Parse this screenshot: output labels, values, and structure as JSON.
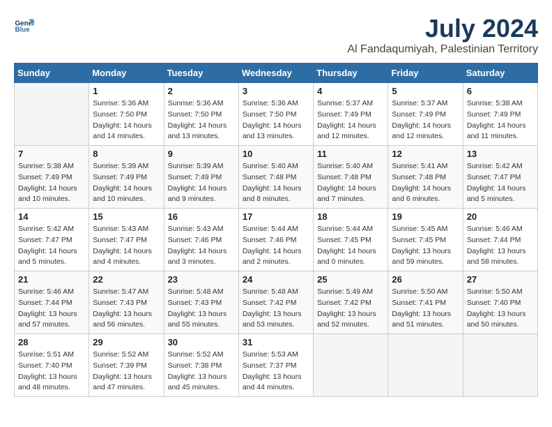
{
  "header": {
    "logo_line1": "General",
    "logo_line2": "Blue",
    "main_title": "July 2024",
    "subtitle": "Al Fandaqumiyah, Palestinian Territory"
  },
  "days_of_week": [
    "Sunday",
    "Monday",
    "Tuesday",
    "Wednesday",
    "Thursday",
    "Friday",
    "Saturday"
  ],
  "weeks": [
    [
      {
        "day": "",
        "info": ""
      },
      {
        "day": "1",
        "info": "Sunrise: 5:36 AM\nSunset: 7:50 PM\nDaylight: 14 hours\nand 14 minutes."
      },
      {
        "day": "2",
        "info": "Sunrise: 5:36 AM\nSunset: 7:50 PM\nDaylight: 14 hours\nand 13 minutes."
      },
      {
        "day": "3",
        "info": "Sunrise: 5:36 AM\nSunset: 7:50 PM\nDaylight: 14 hours\nand 13 minutes."
      },
      {
        "day": "4",
        "info": "Sunrise: 5:37 AM\nSunset: 7:49 PM\nDaylight: 14 hours\nand 12 minutes."
      },
      {
        "day": "5",
        "info": "Sunrise: 5:37 AM\nSunset: 7:49 PM\nDaylight: 14 hours\nand 12 minutes."
      },
      {
        "day": "6",
        "info": "Sunrise: 5:38 AM\nSunset: 7:49 PM\nDaylight: 14 hours\nand 11 minutes."
      }
    ],
    [
      {
        "day": "7",
        "info": "Sunrise: 5:38 AM\nSunset: 7:49 PM\nDaylight: 14 hours\nand 10 minutes."
      },
      {
        "day": "8",
        "info": "Sunrise: 5:39 AM\nSunset: 7:49 PM\nDaylight: 14 hours\nand 10 minutes."
      },
      {
        "day": "9",
        "info": "Sunrise: 5:39 AM\nSunset: 7:49 PM\nDaylight: 14 hours\nand 9 minutes."
      },
      {
        "day": "10",
        "info": "Sunrise: 5:40 AM\nSunset: 7:48 PM\nDaylight: 14 hours\nand 8 minutes."
      },
      {
        "day": "11",
        "info": "Sunrise: 5:40 AM\nSunset: 7:48 PM\nDaylight: 14 hours\nand 7 minutes."
      },
      {
        "day": "12",
        "info": "Sunrise: 5:41 AM\nSunset: 7:48 PM\nDaylight: 14 hours\nand 6 minutes."
      },
      {
        "day": "13",
        "info": "Sunrise: 5:42 AM\nSunset: 7:47 PM\nDaylight: 14 hours\nand 5 minutes."
      }
    ],
    [
      {
        "day": "14",
        "info": "Sunrise: 5:42 AM\nSunset: 7:47 PM\nDaylight: 14 hours\nand 5 minutes."
      },
      {
        "day": "15",
        "info": "Sunrise: 5:43 AM\nSunset: 7:47 PM\nDaylight: 14 hours\nand 4 minutes."
      },
      {
        "day": "16",
        "info": "Sunrise: 5:43 AM\nSunset: 7:46 PM\nDaylight: 14 hours\nand 3 minutes."
      },
      {
        "day": "17",
        "info": "Sunrise: 5:44 AM\nSunset: 7:46 PM\nDaylight: 14 hours\nand 2 minutes."
      },
      {
        "day": "18",
        "info": "Sunrise: 5:44 AM\nSunset: 7:45 PM\nDaylight: 14 hours\nand 0 minutes."
      },
      {
        "day": "19",
        "info": "Sunrise: 5:45 AM\nSunset: 7:45 PM\nDaylight: 13 hours\nand 59 minutes."
      },
      {
        "day": "20",
        "info": "Sunrise: 5:46 AM\nSunset: 7:44 PM\nDaylight: 13 hours\nand 58 minutes."
      }
    ],
    [
      {
        "day": "21",
        "info": "Sunrise: 5:46 AM\nSunset: 7:44 PM\nDaylight: 13 hours\nand 57 minutes."
      },
      {
        "day": "22",
        "info": "Sunrise: 5:47 AM\nSunset: 7:43 PM\nDaylight: 13 hours\nand 56 minutes."
      },
      {
        "day": "23",
        "info": "Sunrise: 5:48 AM\nSunset: 7:43 PM\nDaylight: 13 hours\nand 55 minutes."
      },
      {
        "day": "24",
        "info": "Sunrise: 5:48 AM\nSunset: 7:42 PM\nDaylight: 13 hours\nand 53 minutes."
      },
      {
        "day": "25",
        "info": "Sunrise: 5:49 AM\nSunset: 7:42 PM\nDaylight: 13 hours\nand 52 minutes."
      },
      {
        "day": "26",
        "info": "Sunrise: 5:50 AM\nSunset: 7:41 PM\nDaylight: 13 hours\nand 51 minutes."
      },
      {
        "day": "27",
        "info": "Sunrise: 5:50 AM\nSunset: 7:40 PM\nDaylight: 13 hours\nand 50 minutes."
      }
    ],
    [
      {
        "day": "28",
        "info": "Sunrise: 5:51 AM\nSunset: 7:40 PM\nDaylight: 13 hours\nand 48 minutes."
      },
      {
        "day": "29",
        "info": "Sunrise: 5:52 AM\nSunset: 7:39 PM\nDaylight: 13 hours\nand 47 minutes."
      },
      {
        "day": "30",
        "info": "Sunrise: 5:52 AM\nSunset: 7:38 PM\nDaylight: 13 hours\nand 45 minutes."
      },
      {
        "day": "31",
        "info": "Sunrise: 5:53 AM\nSunset: 7:37 PM\nDaylight: 13 hours\nand 44 minutes."
      },
      {
        "day": "",
        "info": ""
      },
      {
        "day": "",
        "info": ""
      },
      {
        "day": "",
        "info": ""
      }
    ]
  ]
}
